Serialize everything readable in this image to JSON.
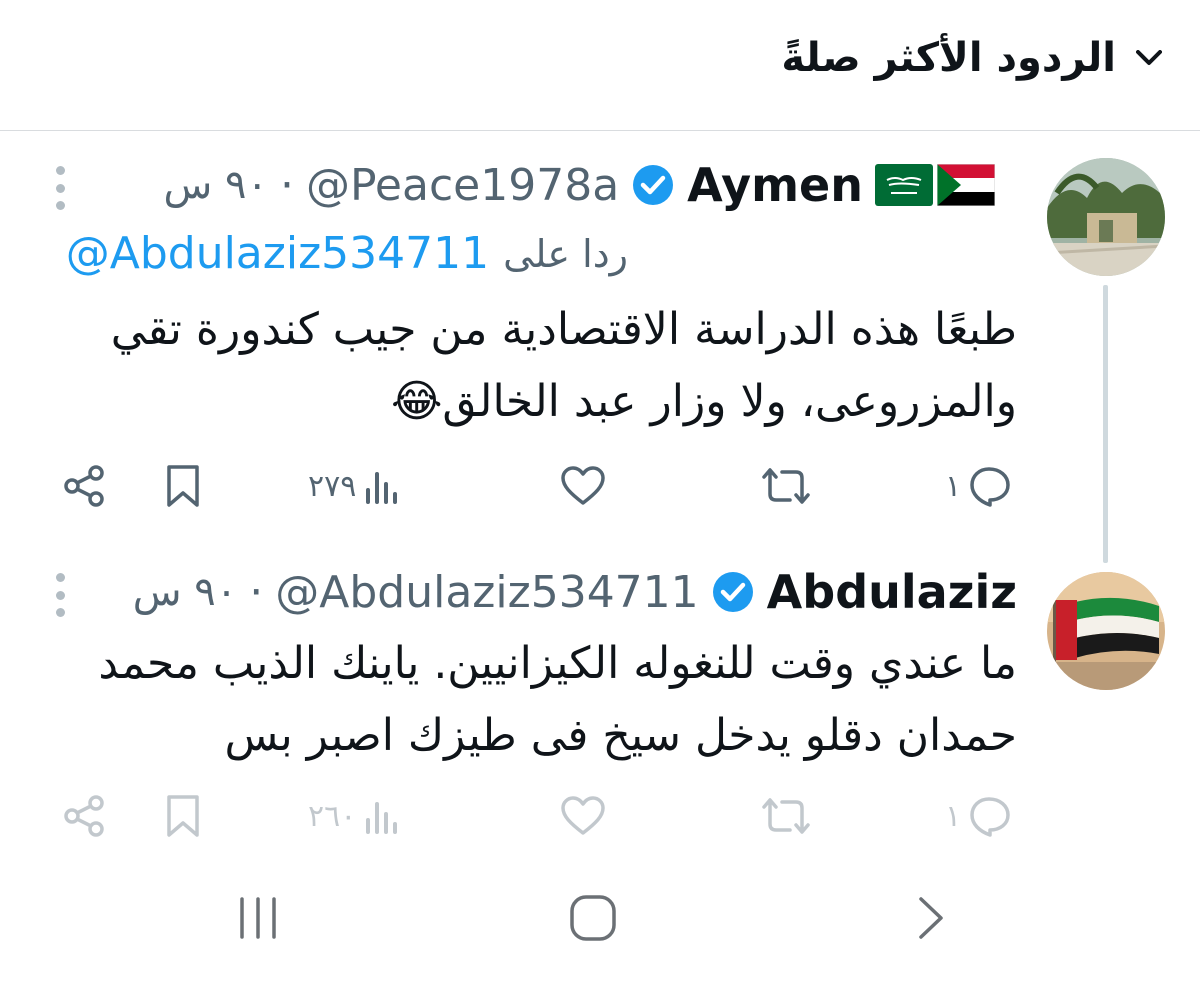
{
  "header": {
    "sort_label": "الردود الأكثر صلةً"
  },
  "tweets": [
    {
      "display_name": "Aymen",
      "handle": "@Peace1978a",
      "time": "٩٠ س",
      "replying_label": "ردا على",
      "replying_handle": "@Abdulaziz534711",
      "line1": "طبعًا هذه  الدراسة الاقتصادية من جيب كندورة تقي",
      "line2": "والمزروعى، ولا وزار عبد الخالق😂",
      "replies": "١",
      "likes": "",
      "views": "٢٧٩"
    },
    {
      "display_name": "Abdulaziz",
      "handle": "@Abdulaziz534711",
      "time": "٩٠ س",
      "line1": "ما عندي وقت للنغوله الكيزانيين. يا​ينك الذيب محمد",
      "line2": "حمدان دقلو يدخل سيخ فى طيزك اصبر بس",
      "replies": "١",
      "views": "٢٦٠"
    }
  ],
  "dot": "·",
  "colors": {
    "accent": "#1d9bf0",
    "muted": "#536471",
    "text": "#0f1419"
  }
}
